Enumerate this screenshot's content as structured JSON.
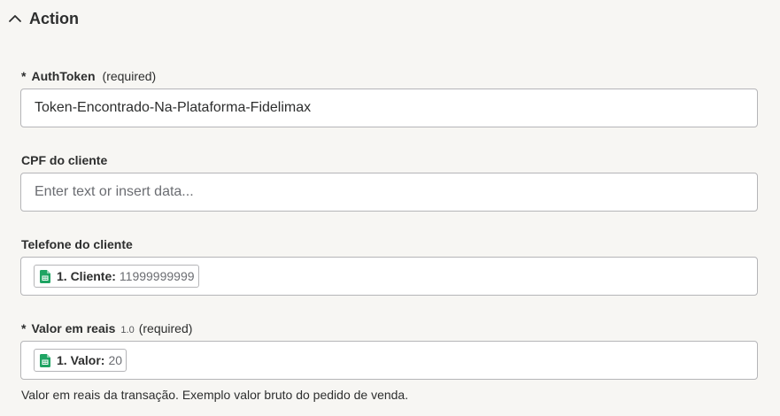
{
  "section": {
    "title": "Action",
    "collapse_icon": "chevron-up-icon"
  },
  "fields": {
    "auth_token": {
      "required_mark": "*",
      "label": "AuthToken",
      "required_text": "(required)",
      "value": "Token-Encontrado-Na-Plataforma-Fidelimax"
    },
    "cpf": {
      "label": "CPF do cliente",
      "placeholder": "Enter text or insert data..."
    },
    "telefone": {
      "label": "Telefone do cliente",
      "pill": {
        "icon": "google-sheets-icon",
        "key": "1. Cliente:",
        "value": "11999999999"
      }
    },
    "valor": {
      "required_mark": "*",
      "label": "Valor em reais",
      "type_hint": "1.0",
      "required_text": "(required)",
      "pill": {
        "icon": "google-sheets-icon",
        "key": "1. Valor:",
        "value": "20"
      },
      "help": "Valor em reais da transação. Exemplo valor bruto do pedido de venda."
    }
  },
  "colors": {
    "background": "#f7f6f3",
    "sheets_green": "#1fa463",
    "border": "#b5b5b8"
  }
}
